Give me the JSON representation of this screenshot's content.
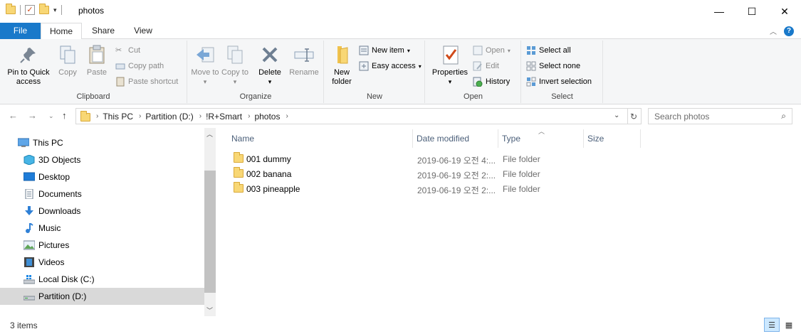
{
  "window": {
    "title": "photos"
  },
  "ribbon_tabs": {
    "file": "File",
    "home": "Home",
    "share": "Share",
    "view": "View"
  },
  "clipboard": {
    "pin": "Pin to Quick access",
    "copy": "Copy",
    "paste": "Paste",
    "cut": "Cut",
    "copy_path": "Copy path",
    "paste_shortcut": "Paste shortcut",
    "label": "Clipboard"
  },
  "organize": {
    "move_to": "Move to",
    "copy_to": "Copy to",
    "delete": "Delete",
    "rename": "Rename",
    "label": "Organize"
  },
  "new": {
    "new_folder": "New folder",
    "new_item": "New item",
    "easy_access": "Easy access",
    "label": "New"
  },
  "open": {
    "properties": "Properties",
    "open": "Open",
    "edit": "Edit",
    "history": "History",
    "label": "Open"
  },
  "select": {
    "select_all": "Select all",
    "select_none": "Select none",
    "invert": "Invert selection",
    "label": "Select"
  },
  "address": {
    "crumbs": [
      "This PC",
      "Partition (D:)",
      "!R+Smart",
      "photos"
    ],
    "search_placeholder": "Search photos"
  },
  "nav": {
    "items": [
      {
        "label": "This PC",
        "icon": "computer-icon"
      },
      {
        "label": "3D Objects",
        "icon": "cube-icon"
      },
      {
        "label": "Desktop",
        "icon": "desktop-icon"
      },
      {
        "label": "Documents",
        "icon": "documents-icon"
      },
      {
        "label": "Downloads",
        "icon": "download-arrow-icon"
      },
      {
        "label": "Music",
        "icon": "music-note-icon"
      },
      {
        "label": "Pictures",
        "icon": "pictures-icon"
      },
      {
        "label": "Videos",
        "icon": "film-icon"
      },
      {
        "label": "Local Disk (C:)",
        "icon": "windows-drive-icon"
      },
      {
        "label": "Partition (D:)",
        "icon": "drive-icon",
        "selected": true
      }
    ]
  },
  "list": {
    "columns": [
      "Name",
      "Date modified",
      "Type",
      "Size"
    ],
    "rows": [
      {
        "name": "001 dummy",
        "date": "2019-06-19 오전 4:...",
        "type": "File folder"
      },
      {
        "name": "002 banana",
        "date": "2019-06-19 오전 2:...",
        "type": "File folder"
      },
      {
        "name": "003 pineapple",
        "date": "2019-06-19 오전 2:...",
        "type": "File folder"
      }
    ]
  },
  "status": {
    "item_count": "3 items"
  },
  "colors": {
    "accent": "#1979ca",
    "folder": "#f8d775",
    "selection": "#d9d9d9"
  }
}
